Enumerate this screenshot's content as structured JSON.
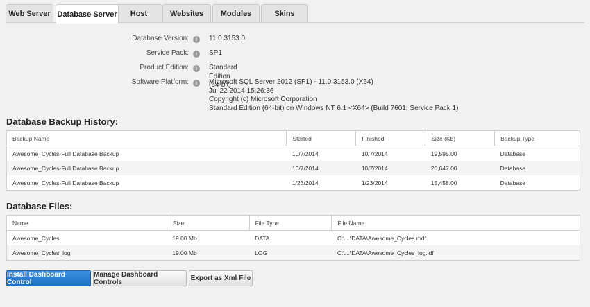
{
  "tabs": [
    {
      "label": "Web Server",
      "active": false
    },
    {
      "label": "Database Server",
      "active": true
    },
    {
      "label": "Host",
      "active": false
    },
    {
      "label": "Websites",
      "active": false
    },
    {
      "label": "Modules",
      "active": false
    },
    {
      "label": "Skins",
      "active": false
    }
  ],
  "info": {
    "version_label": "Database Version:",
    "version_value": "11.0.3153.0",
    "service_pack_label": "Service Pack:",
    "service_pack_value": "SP1",
    "edition_label": "Product Edition:",
    "edition_value": "Standard Edition (64-bit)",
    "platform_label": "Software Platform:",
    "platform_lines": [
      "Microsoft SQL Server 2012 (SP1) - 11.0.3153.0 (X64)",
      "Jul 22 2014 15:26:36",
      "Copyright (c) Microsoft Corporation",
      "Standard Edition (64-bit) on Windows NT 6.1 <X64> (Build 7601: Service Pack 1)"
    ],
    "icon_glyph": "i"
  },
  "backup": {
    "heading": "Database Backup History:",
    "columns": [
      "Backup Name",
      "Started",
      "Finished",
      "Size (Kb)",
      "Backup Type"
    ],
    "rows": [
      [
        "Awesome_Cycles-Full Database Backup",
        "10/7/2014",
        "10/7/2014",
        "19,595.00",
        "Database"
      ],
      [
        "Awesome_Cycles-Full Database Backup",
        "10/7/2014",
        "10/7/2014",
        "20,647.00",
        "Database"
      ],
      [
        "Awesome_Cycles-Full Database Backup",
        "1/23/2014",
        "1/23/2014",
        "15,458.00",
        "Database"
      ]
    ]
  },
  "files": {
    "heading": "Database Files:",
    "columns": [
      "Name",
      "Size",
      "File Type",
      "File Name"
    ],
    "rows": [
      [
        "Awesome_Cycles",
        "19.00 Mb",
        "DATA",
        "C:\\...\\DATA\\Awesome_Cycles.mdf"
      ],
      [
        "Awesome_Cycles_log",
        "19.00 Mb",
        "LOG",
        "C:\\...\\DATA\\Awesome_Cycles_log.ldf"
      ]
    ]
  },
  "buttons": {
    "install": "Install Dashboard Control",
    "manage": "Manage Dashboard Controls",
    "export": "Export as Xml File"
  },
  "colors": {
    "primary_button": "#1d6fc4",
    "background": "#f1f1f1"
  }
}
